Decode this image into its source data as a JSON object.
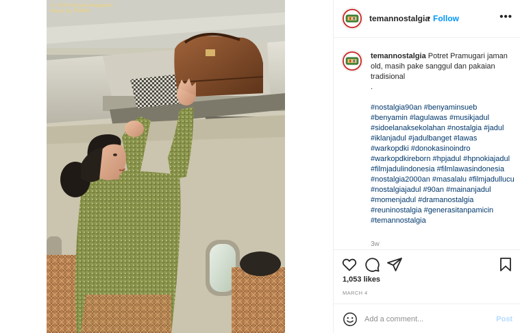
{
  "photo": {
    "alt_name": "stewardess-photo",
    "credit_lines": [
      "© 1974 Garuda Magazine",
      "Repro by TEMPO"
    ]
  },
  "header": {
    "username": "temannostalgia",
    "separator": "•",
    "follow_label": "Follow",
    "more_icon": "more-horizontal-icon"
  },
  "caption": {
    "username": "temannostalgia",
    "text": "Potret Pramugari jaman old, masih pake sanggul dan pakaian tradisional",
    "dot": ".",
    "hashtags": "#nostalgia90an #benyaminsueb #benyamin #lagulawas #musikjadul #sidoelanaksekolahan #nostalgia #jadul #iklanjadul #jadulbanget #lawas #warkopdki #donokasinoindro #warkopdkireborn #hpjadul #hpnokiajadul #filmjadulindonesia #filmlawasindonesia #nostalgia2000an #masalalu #filmjadullucu #nostalgiajadul #90an #mainanjadul #momenjadul #dramanostalgia #reuninostalgia #generasitanpamicin #temannostalgia",
    "age": "3w"
  },
  "actions": {
    "icons": [
      "heart-icon",
      "comment-icon",
      "share-icon",
      "bookmark-icon"
    ]
  },
  "stats": {
    "likes": "1,053 likes",
    "date": "MARCH 4"
  },
  "comment": {
    "placeholder": "Add a comment...",
    "post_label": "Post",
    "emoji_icon": "emoji-icon"
  },
  "colors": {
    "link_blue": "#0095f6",
    "hashtag_blue": "#00376b",
    "post_disabled": "#b3dbff",
    "muted_text": "#8e8e8e",
    "border": "#efefef"
  }
}
